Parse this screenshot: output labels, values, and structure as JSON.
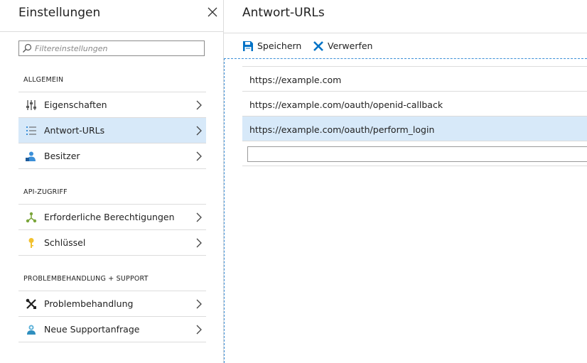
{
  "left_blade": {
    "title": "Einstellungen",
    "filter_placeholder": "Filtereinstellungen",
    "sections": [
      {
        "label": "ALLGEMEIN",
        "items": [
          {
            "label": "Eigenschaften",
            "icon": "properties-icon",
            "selected": false
          },
          {
            "label": "Antwort-URLs",
            "icon": "list-icon",
            "selected": true
          },
          {
            "label": "Besitzer",
            "icon": "owner-icon",
            "selected": false
          }
        ]
      },
      {
        "label": "API-ZUGRIFF",
        "items": [
          {
            "label": "Erforderliche Berechtigungen",
            "icon": "permissions-icon",
            "selected": false
          },
          {
            "label": "Schlüssel",
            "icon": "key-icon",
            "selected": false
          }
        ]
      },
      {
        "label": "PROBLEMBEHANDLUNG + SUPPORT",
        "items": [
          {
            "label": "Problembehandlung",
            "icon": "tools-icon",
            "selected": false
          },
          {
            "label": "Neue Supportanfrage",
            "icon": "support-icon",
            "selected": false
          }
        ]
      }
    ]
  },
  "right_blade": {
    "title": "Antwort-URLs",
    "toolbar": {
      "save_label": "Speichern",
      "discard_label": "Verwerfen"
    },
    "urls": [
      {
        "value": "https://example.com",
        "selected": false
      },
      {
        "value": "https://example.com/oauth/openid-callback",
        "selected": false
      },
      {
        "value": "https://example.com/oauth/perform_login",
        "selected": true
      }
    ],
    "new_url_value": ""
  },
  "colors": {
    "selection": "#d7e9f9",
    "accent": "#0072c6",
    "divider": "#dcdcdc"
  }
}
